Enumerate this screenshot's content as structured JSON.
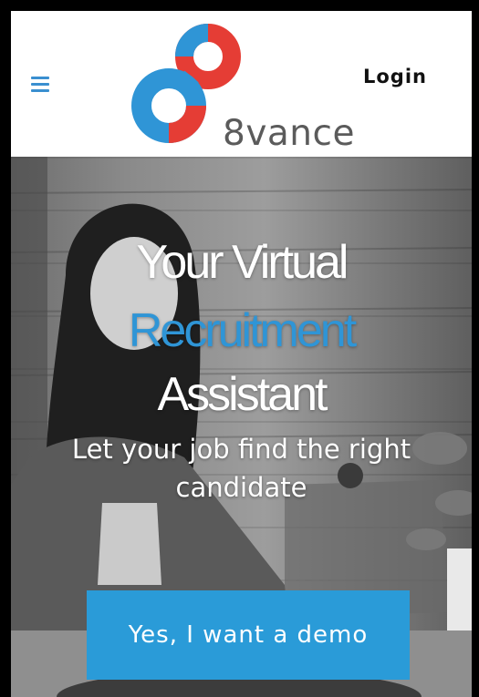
{
  "header": {
    "menu_icon": "hamburger-menu-icon",
    "logo": {
      "text": "8vance",
      "colors": {
        "red": "#e53d35",
        "blue": "#2f95d6",
        "text": "#5b5b5b"
      }
    },
    "login_label": "Login"
  },
  "hero": {
    "title_line1": "Your Virtual",
    "title_line2": "Recruitment",
    "title_line3": "Assistant",
    "subtitle_line1": "Let your job find the right",
    "subtitle_line2": "candidate",
    "cta_label": "Yes, I want a demo",
    "accent_color": "#2f95d6",
    "cta_color": "#2a9bd8"
  }
}
